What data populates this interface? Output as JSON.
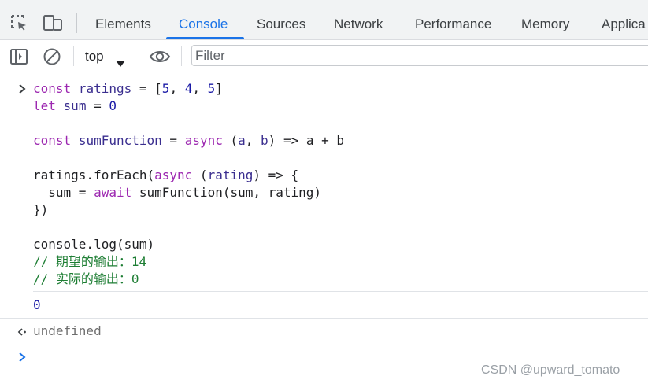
{
  "tabbar": {
    "icons": {
      "inspect": "inspect-element-icon",
      "device": "device-toolbar-icon"
    },
    "tabs": [
      {
        "label": "Elements",
        "active": false
      },
      {
        "label": "Console",
        "active": true
      },
      {
        "label": "Sources",
        "active": false
      },
      {
        "label": "Network",
        "active": false
      },
      {
        "label": "Performance",
        "active": false
      },
      {
        "label": "Memory",
        "active": false
      },
      {
        "label": "Applica",
        "active": false
      }
    ]
  },
  "toolbar": {
    "icons": {
      "sidebar": "sidebar-toggle-icon",
      "clear": "clear-console-icon",
      "eye": "eye-icon"
    },
    "context": "top",
    "filter_placeholder": "Filter"
  },
  "console": {
    "input_lines": {
      "l1": {
        "k": "const",
        "v": "ratings",
        "eq": " = ",
        "open": "[",
        "n1": "5",
        "c1": ", ",
        "n2": "4",
        "c2": ", ",
        "n3": "5",
        "close": "]"
      },
      "l2": {
        "k": "let",
        "v": "sum",
        "eq": " = ",
        "n": "0"
      },
      "l4": {
        "k": "const",
        "v": "sumFunction",
        "eq": " = ",
        "k2": "async",
        "p1": " (",
        "a": "a",
        "c": ", ",
        "b": "b",
        "rest": ") => a + b"
      },
      "l6": {
        "pre": "ratings.forEach(",
        "k": "async",
        "p1": " (",
        "a": "rating",
        "rest": ") => {"
      },
      "l7": {
        "pre": "  sum = ",
        "k": "await",
        "rest": " sumFunction(sum, rating)"
      },
      "l8": {
        "text": "})"
      },
      "l10": {
        "text": "console.log(sum)"
      },
      "l11": {
        "text": "// 期望的输出：14"
      },
      "l12": {
        "text": "// 实际的输出：0"
      }
    },
    "log_output": "0",
    "return_value": "undefined"
  },
  "watermark": "CSDN @upward_tomato",
  "colors": {
    "accent": "#1a73e8",
    "keyword": "#9c27b0",
    "number": "#1a1aa6",
    "comment": "#1e7e34"
  }
}
